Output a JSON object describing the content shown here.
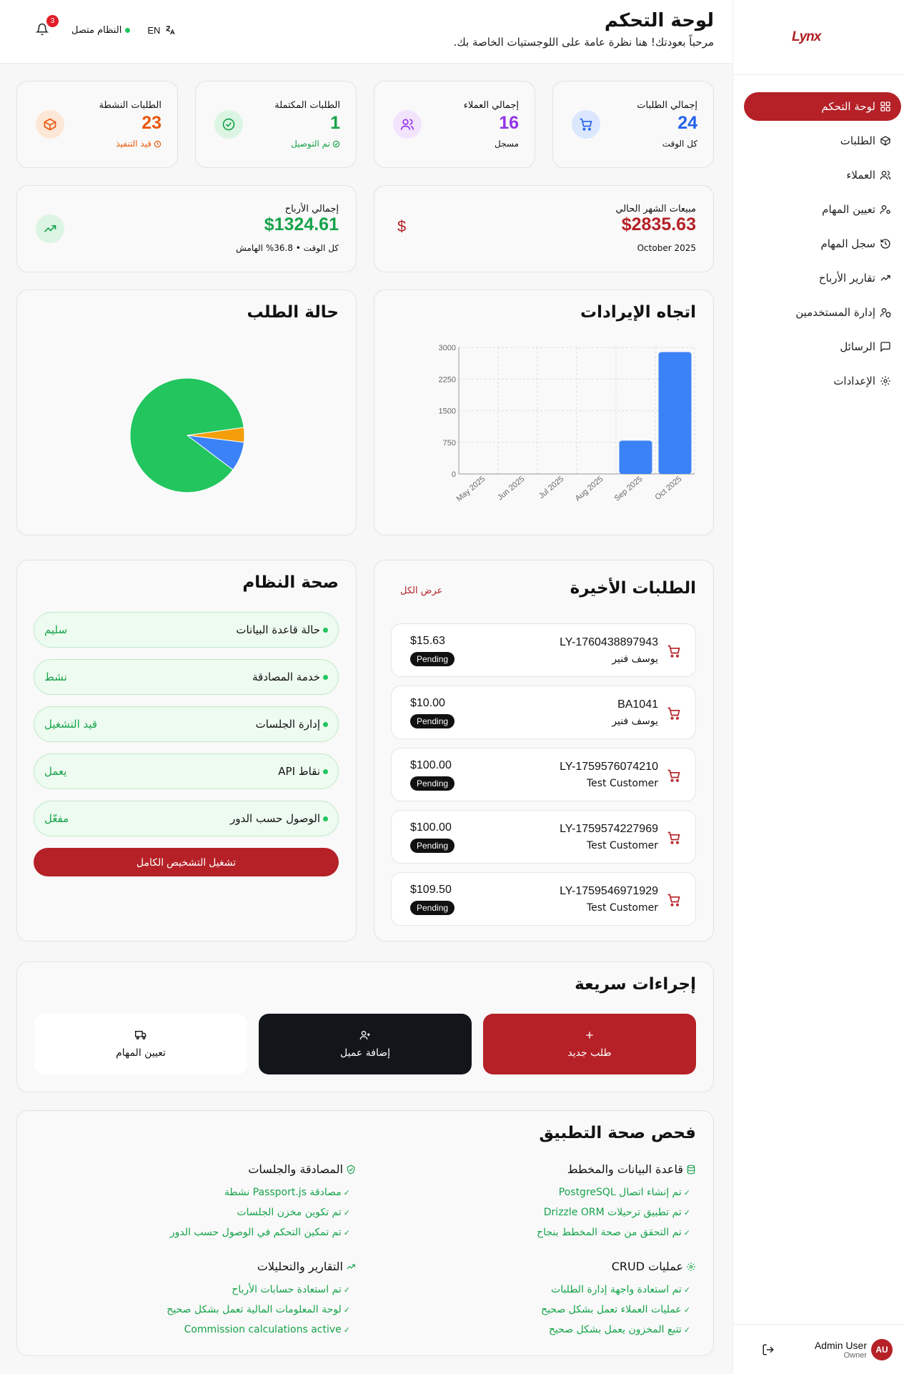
{
  "sidebar": {
    "logo": "Lynx",
    "items": [
      {
        "label": "لوحة التحكم",
        "icon": "dashboard-icon",
        "active": true
      },
      {
        "label": "الطلبات",
        "icon": "package-icon",
        "active": false
      },
      {
        "label": "العملاء",
        "icon": "users-icon",
        "active": false
      },
      {
        "label": "تعيين المهام",
        "icon": "user-cog-icon",
        "active": false
      },
      {
        "label": "سجل المهام",
        "icon": "history-icon",
        "active": false
      },
      {
        "label": "تقارير الأرباح",
        "icon": "trending-up-icon",
        "active": false
      },
      {
        "label": "إدارة المستخدمين",
        "icon": "user-shield-icon",
        "active": false
      },
      {
        "label": "الرسائل",
        "icon": "message-icon",
        "active": false
      },
      {
        "label": "الإعدادات",
        "icon": "gear-icon",
        "active": false
      }
    ],
    "user": {
      "initials": "AU",
      "name": "Admin User",
      "role": "Owner"
    }
  },
  "header": {
    "title": "لوحة التحكم",
    "subtitle": "مرحباً بعودتك! هنا نظرة عامة على اللوجستيات الخاصة بك.",
    "notifications": "3",
    "status": "النظام متصل",
    "lang": "EN"
  },
  "stats": [
    {
      "label": "إجمالي الطلبات",
      "value": "24",
      "note": "كل الوقت",
      "color": "#2563eb",
      "icon": "cart-icon"
    },
    {
      "label": "إجمالي العملاء",
      "value": "16",
      "note": "مسجل",
      "color": "#9333ea",
      "icon": "users-icon"
    },
    {
      "label": "الطلبات المكتملة",
      "value": "1",
      "note": "تم التوصيل",
      "color": "#16a34a",
      "icon": "check-circle-icon"
    },
    {
      "label": "الطلبات النشطة",
      "value": "23",
      "note": "قيد التنفيذ",
      "color": "#ea580c",
      "icon": "package-icon"
    }
  ],
  "money": {
    "monthly": {
      "label": "مبيعات الشهر الحالي",
      "value": "$2835.63",
      "note": "October 2025"
    },
    "profit": {
      "label": "إجمالي الأرباح",
      "value": "$1324.61",
      "note": "كل الوقت • 36.8% الهامش"
    }
  },
  "revenue": {
    "title": "اتجاه الإيرادات"
  },
  "status_chart": {
    "title": "حالة الطلب"
  },
  "chart_data": [
    {
      "type": "bar",
      "categories": [
        "May 2025",
        "Jun 2025",
        "Jul 2025",
        "Aug 2025",
        "Sep 2025",
        "Oct 2025"
      ],
      "values": [
        0,
        0,
        0,
        0,
        790,
        2890
      ],
      "title": "اتجاه الإيرادات",
      "ylim": [
        0,
        3000
      ],
      "yticks": [
        0,
        750,
        1500,
        2250,
        3000
      ],
      "grid": true,
      "color": "#3b82f6"
    },
    {
      "type": "pie",
      "title": "حالة الطلب",
      "slices": [
        {
          "value": 21,
          "color": "#22c55e"
        },
        {
          "value": 2,
          "color": "#3b82f6"
        },
        {
          "value": 1,
          "color": "#f59e0b"
        }
      ]
    }
  ],
  "recent": {
    "title": "الطلبات الأخيرة",
    "view_all": "عرض الكل",
    "orders": [
      {
        "id": "LY-1760438897943",
        "customer": "يوسف فنير",
        "amount": "$15.63",
        "status": "Pending"
      },
      {
        "id": "BA1041",
        "customer": "يوسف فنير",
        "amount": "$10.00",
        "status": "Pending"
      },
      {
        "id": "LY-1759576074210",
        "customer": "Test Customer",
        "amount": "$100.00",
        "status": "Pending"
      },
      {
        "id": "LY-1759574227969",
        "customer": "Test Customer",
        "amount": "$100.00",
        "status": "Pending"
      },
      {
        "id": "LY-1759546971929",
        "customer": "Test Customer",
        "amount": "$109.50",
        "status": "Pending"
      }
    ]
  },
  "health": {
    "title": "صحة النظام",
    "items": [
      {
        "name": "حالة قاعدة البيانات",
        "value": "سليم"
      },
      {
        "name": "خدمة المصادقة",
        "value": "نشط"
      },
      {
        "name": "إدارة الجلسات",
        "value": "قيد التشغيل"
      },
      {
        "name": "نقاط API",
        "value": "يعمل"
      },
      {
        "name": "الوصول حسب الدور",
        "value": "مفعّل"
      }
    ],
    "button": "تشغيل التشخيص الكامل"
  },
  "quick": {
    "title": "إجراءات سريعة",
    "new_order": "طلب جديد",
    "add_customer": "إضافة عميل",
    "assign": "تعيين المهام"
  },
  "app_check": {
    "title": "فحص صحة التطبيق",
    "groups": [
      {
        "title": "قاعدة البيانات والمخطط",
        "icon": "database-icon",
        "lines": [
          "تم إنشاء اتصال PostgreSQL",
          "تم تطبيق ترحيلات Drizzle ORM",
          "تم التحقق من صحة المخطط بنجاح"
        ]
      },
      {
        "title": "المصادقة والجلسات",
        "icon": "shield-check-icon",
        "lines": [
          "مصادقة Passport.js نشطة",
          "تم تكوين مخزن الجلسات",
          "تم تمكين التحكم في الوصول حسب الدور"
        ]
      },
      {
        "title": "عمليات CRUD",
        "icon": "gear-icon",
        "lines": [
          "تم استعادة واجهة إدارة الطلبات",
          "عمليات العملاء تعمل بشكل صحيح",
          "تتبع المخزون يعمل بشكل صحيح"
        ]
      },
      {
        "title": "التقارير والتحليلات",
        "icon": "trending-up-icon",
        "lines": [
          "تم استعادة حسابات الأرباح",
          "لوحة المعلومات المالية تعمل بشكل صحيح",
          "Commission calculations active"
        ]
      }
    ]
  }
}
